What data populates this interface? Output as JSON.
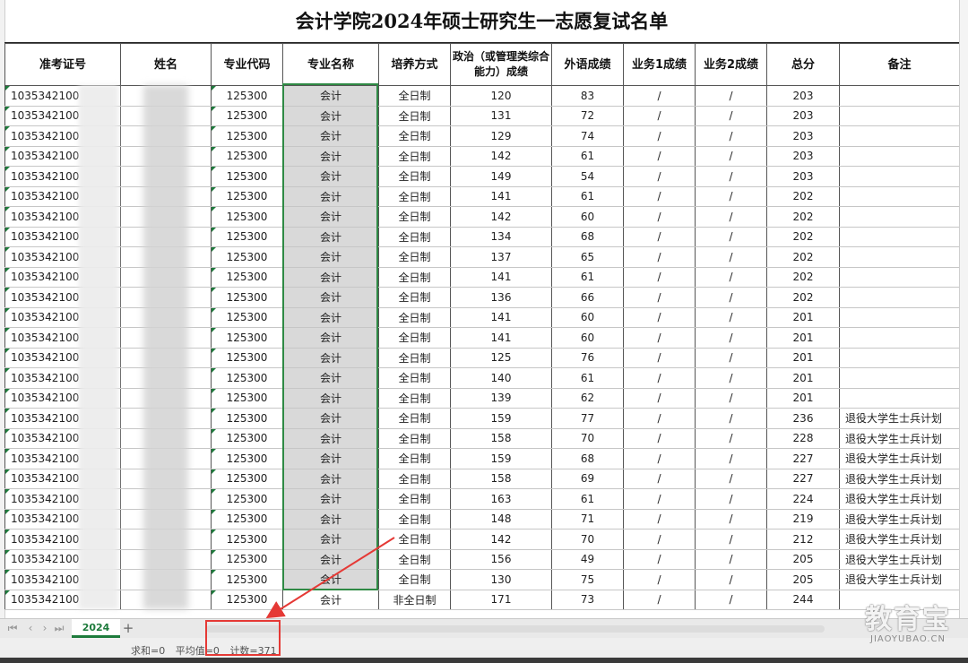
{
  "title": "会计学院2024年硕士研究生一志愿复试名单",
  "headers": [
    "准考证号",
    "姓名",
    "专业代码",
    "专业名称",
    "培养方式",
    "政治（或管理类综合能力）成绩",
    "外语成绩",
    "业务1成绩",
    "业务2成绩",
    "总分",
    "备注"
  ],
  "rows": [
    [
      "1035342100",
      "",
      "125300",
      "会计",
      "全日制",
      "120",
      "83",
      "/",
      "/",
      "203",
      ""
    ],
    [
      "1035342100",
      "",
      "125300",
      "会计",
      "全日制",
      "131",
      "72",
      "/",
      "/",
      "203",
      ""
    ],
    [
      "1035342100",
      "",
      "125300",
      "会计",
      "全日制",
      "129",
      "74",
      "/",
      "/",
      "203",
      ""
    ],
    [
      "1035342100",
      "",
      "125300",
      "会计",
      "全日制",
      "142",
      "61",
      "/",
      "/",
      "203",
      ""
    ],
    [
      "1035342100",
      "",
      "125300",
      "会计",
      "全日制",
      "149",
      "54",
      "/",
      "/",
      "203",
      ""
    ],
    [
      "1035342100",
      "",
      "125300",
      "会计",
      "全日制",
      "141",
      "61",
      "/",
      "/",
      "202",
      ""
    ],
    [
      "1035342100",
      "",
      "125300",
      "会计",
      "全日制",
      "142",
      "60",
      "/",
      "/",
      "202",
      ""
    ],
    [
      "1035342100",
      "",
      "125300",
      "会计",
      "全日制",
      "134",
      "68",
      "/",
      "/",
      "202",
      ""
    ],
    [
      "1035342100",
      "",
      "125300",
      "会计",
      "全日制",
      "137",
      "65",
      "/",
      "/",
      "202",
      ""
    ],
    [
      "1035342100",
      "",
      "125300",
      "会计",
      "全日制",
      "141",
      "61",
      "/",
      "/",
      "202",
      ""
    ],
    [
      "1035342100",
      "",
      "125300",
      "会计",
      "全日制",
      "136",
      "66",
      "/",
      "/",
      "202",
      ""
    ],
    [
      "1035342100",
      "",
      "125300",
      "会计",
      "全日制",
      "141",
      "60",
      "/",
      "/",
      "201",
      ""
    ],
    [
      "1035342100",
      "",
      "125300",
      "会计",
      "全日制",
      "141",
      "60",
      "/",
      "/",
      "201",
      ""
    ],
    [
      "1035342100",
      "",
      "125300",
      "会计",
      "全日制",
      "125",
      "76",
      "/",
      "/",
      "201",
      ""
    ],
    [
      "1035342100",
      "",
      "125300",
      "会计",
      "全日制",
      "140",
      "61",
      "/",
      "/",
      "201",
      ""
    ],
    [
      "1035342100",
      "",
      "125300",
      "会计",
      "全日制",
      "139",
      "62",
      "/",
      "/",
      "201",
      ""
    ],
    [
      "1035342100",
      "",
      "125300",
      "会计",
      "全日制",
      "159",
      "77",
      "/",
      "/",
      "236",
      "退役大学生士兵计划"
    ],
    [
      "1035342100",
      "",
      "125300",
      "会计",
      "全日制",
      "158",
      "70",
      "/",
      "/",
      "228",
      "退役大学生士兵计划"
    ],
    [
      "1035342100",
      "",
      "125300",
      "会计",
      "全日制",
      "159",
      "68",
      "/",
      "/",
      "227",
      "退役大学生士兵计划"
    ],
    [
      "1035342100",
      "",
      "125300",
      "会计",
      "全日制",
      "158",
      "69",
      "/",
      "/",
      "227",
      "退役大学生士兵计划"
    ],
    [
      "1035342100",
      "",
      "125300",
      "会计",
      "全日制",
      "163",
      "61",
      "/",
      "/",
      "224",
      "退役大学生士兵计划"
    ],
    [
      "1035342100",
      "",
      "125300",
      "会计",
      "全日制",
      "148",
      "71",
      "/",
      "/",
      "219",
      "退役大学生士兵计划"
    ],
    [
      "1035342100",
      "",
      "125300",
      "会计",
      "全日制",
      "142",
      "70",
      "/",
      "/",
      "212",
      "退役大学生士兵计划"
    ],
    [
      "1035342100",
      "",
      "125300",
      "会计",
      "全日制",
      "156",
      "49",
      "/",
      "/",
      "205",
      "退役大学生士兵计划"
    ],
    [
      "1035342100",
      "",
      "125300",
      "会计",
      "全日制",
      "130",
      "75",
      "/",
      "/",
      "205",
      "退役大学生士兵计划"
    ],
    [
      "1035342100",
      "",
      "125300",
      "会计",
      "非全日制",
      "171",
      "73",
      "/",
      "/",
      "244",
      ""
    ]
  ],
  "sheet_tab": "2024",
  "add_sheet_label": "+",
  "status": {
    "left": "",
    "sum": "求和=0",
    "avg": "平均值=0",
    "count": "计数=371"
  },
  "watermark": {
    "main": "教育宝",
    "sub": "JIAOYUBAO.CN"
  },
  "colors": {
    "accent": "#1e7b3c",
    "highlight": "#e53935",
    "selection_fill": "#d9d9d9"
  },
  "icons": [
    "nav-first-icon",
    "nav-prev-icon",
    "nav-next-icon",
    "nav-last-icon",
    "plus-icon",
    "arrow-annotation"
  ]
}
